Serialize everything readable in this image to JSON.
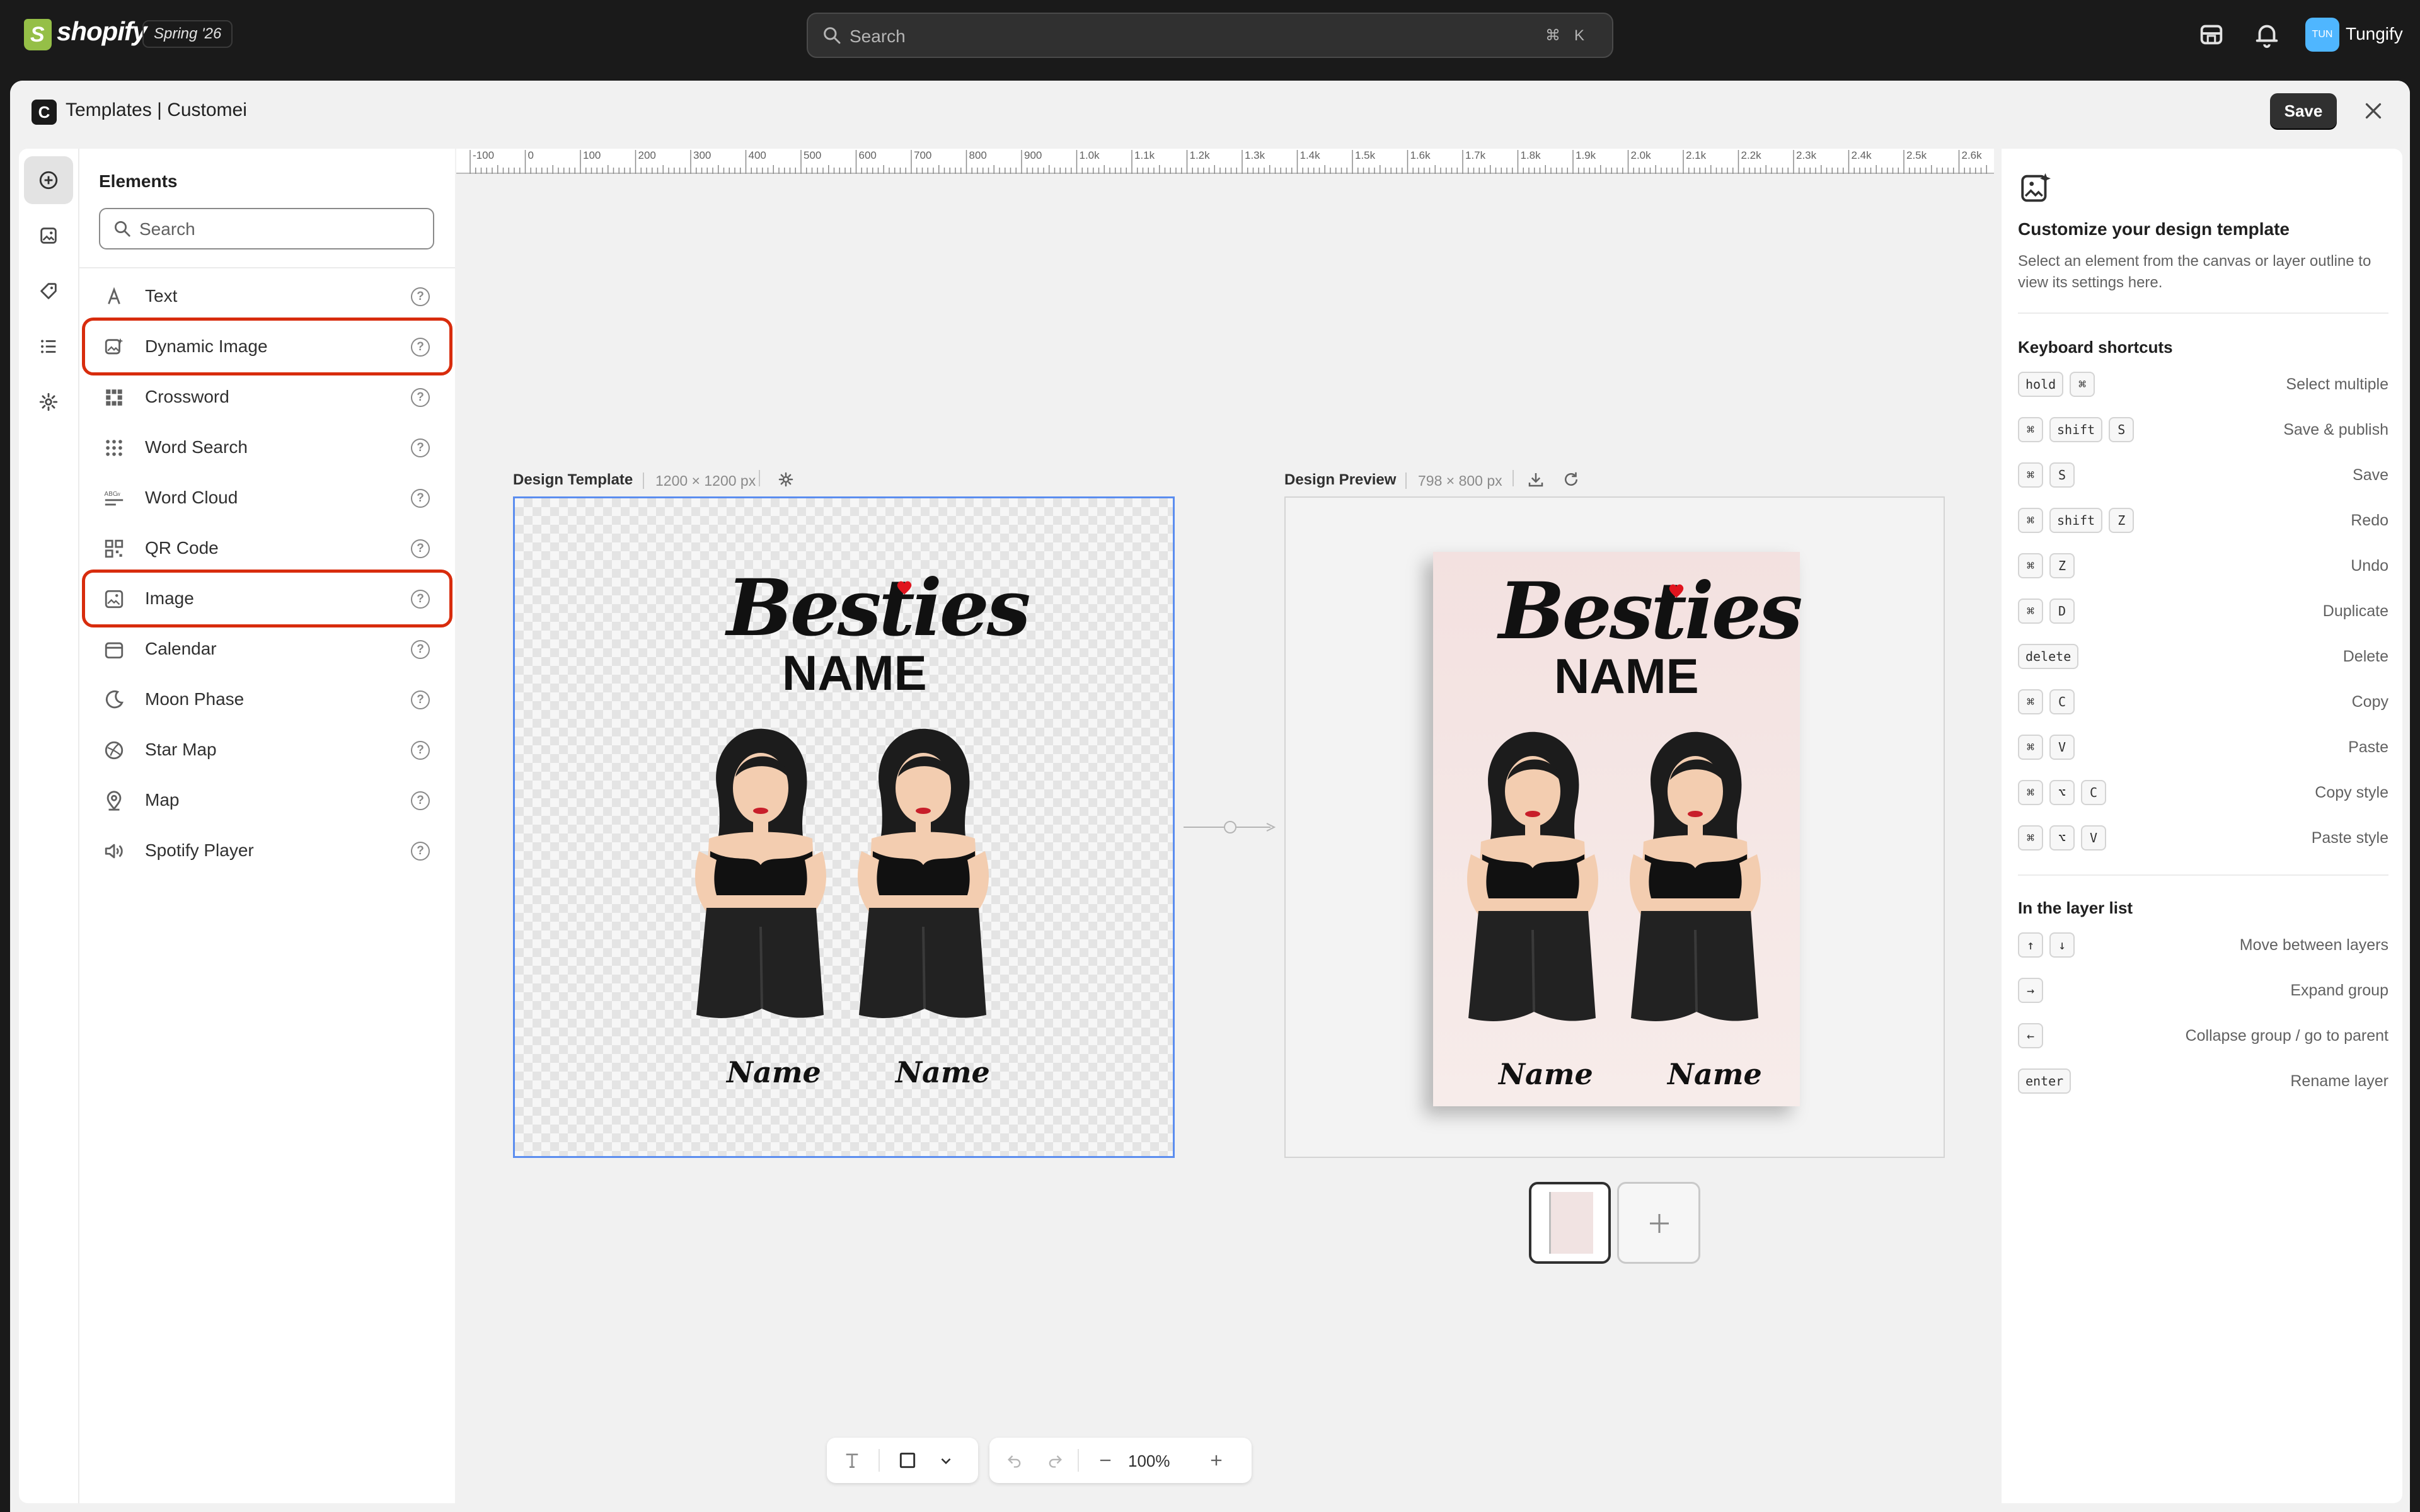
{
  "topbar": {
    "logo": "shopify",
    "edition": "Spring '26",
    "search_placeholder": "Search",
    "search_keys": [
      "⌘",
      "K"
    ],
    "icons": [
      "store-icon",
      "bell-icon"
    ],
    "avatar_initials": "TUN",
    "store_name": "Tungify"
  },
  "window": {
    "app_icon": "C",
    "title": "Templates | Customei",
    "save_label": "Save"
  },
  "rail": {
    "items": [
      "add-element-icon",
      "image-icon",
      "tag-icon",
      "layers-list-icon",
      "settings-icon"
    ],
    "active": 0
  },
  "elements_panel": {
    "title": "Elements",
    "search_placeholder": "Search",
    "items": [
      {
        "label": "Text",
        "icon": "text-icon",
        "highlighted": false
      },
      {
        "label": "Dynamic Image",
        "icon": "dynamic-image-icon",
        "highlighted": true
      },
      {
        "label": "Crossword",
        "icon": "crossword-icon",
        "highlighted": false
      },
      {
        "label": "Word Search",
        "icon": "word-search-icon",
        "highlighted": false
      },
      {
        "label": "Word Cloud",
        "icon": "word-cloud-icon",
        "highlighted": false
      },
      {
        "label": "QR Code",
        "icon": "qr-code-icon",
        "highlighted": false
      },
      {
        "label": "Image",
        "icon": "image-icon",
        "highlighted": true
      },
      {
        "label": "Calendar",
        "icon": "calendar-icon",
        "highlighted": false
      },
      {
        "label": "Moon Phase",
        "icon": "moon-icon",
        "highlighted": false
      },
      {
        "label": "Star Map",
        "icon": "star-map-icon",
        "highlighted": false
      },
      {
        "label": "Map",
        "icon": "map-pin-icon",
        "highlighted": false
      },
      {
        "label": "Spotify Player",
        "icon": "speaker-icon",
        "highlighted": false
      }
    ]
  },
  "ruler": {
    "labels": [
      "-100",
      "0",
      "100",
      "200",
      "300",
      "400",
      "500",
      "600",
      "700",
      "800",
      "900",
      "1.0k",
      "1.1k",
      "1.2k",
      "1.3k",
      "1.4k",
      "1.5k",
      "1.6k",
      "1.7k",
      "1.8k",
      "1.9k",
      "2.0k",
      "2.1k",
      "2.2k",
      "2.3k",
      "2.4k",
      "2.5k",
      "2.6k"
    ]
  },
  "design_template": {
    "label": "Design Template",
    "size": "1200 × 1200 px",
    "title_text": "Besties",
    "name_text": "NAME",
    "left_name": "Name",
    "right_name": "Name"
  },
  "design_preview": {
    "label": "Design Preview",
    "size": "798 × 800 px",
    "title_text": "Besties",
    "name_text": "NAME",
    "left_name": "Name",
    "right_name": "Name"
  },
  "toolbar": {
    "zoom": "100%"
  },
  "right_panel": {
    "title": "Customize your design template",
    "description": "Select an element from the canvas or layer outline to view its settings here.",
    "shortcuts_heading": "Keyboard shortcuts",
    "shortcuts": [
      {
        "keys": [
          "hold",
          "⌘"
        ],
        "action": "Select multiple"
      },
      {
        "keys": [
          "⌘",
          "shift",
          "S"
        ],
        "action": "Save & publish"
      },
      {
        "keys": [
          "⌘",
          "S"
        ],
        "action": "Save"
      },
      {
        "keys": [
          "⌘",
          "shift",
          "Z"
        ],
        "action": "Redo"
      },
      {
        "keys": [
          "⌘",
          "Z"
        ],
        "action": "Undo"
      },
      {
        "keys": [
          "⌘",
          "D"
        ],
        "action": "Duplicate"
      },
      {
        "keys": [
          "delete"
        ],
        "action": "Delete"
      },
      {
        "keys": [
          "⌘",
          "C"
        ],
        "action": "Copy"
      },
      {
        "keys": [
          "⌘",
          "V"
        ],
        "action": "Paste"
      },
      {
        "keys": [
          "⌘",
          "⌥",
          "C"
        ],
        "action": "Copy style"
      },
      {
        "keys": [
          "⌘",
          "⌥",
          "V"
        ],
        "action": "Paste style"
      }
    ],
    "layer_heading": "In the layer list",
    "layer_shortcuts": [
      {
        "keys": [
          "↑",
          "↓"
        ],
        "action": "Move between layers"
      },
      {
        "keys": [
          "→"
        ],
        "action": "Expand group"
      },
      {
        "keys": [
          "←"
        ],
        "action": "Collapse group / go to parent"
      },
      {
        "keys": [
          "enter"
        ],
        "action": "Rename layer"
      }
    ]
  }
}
